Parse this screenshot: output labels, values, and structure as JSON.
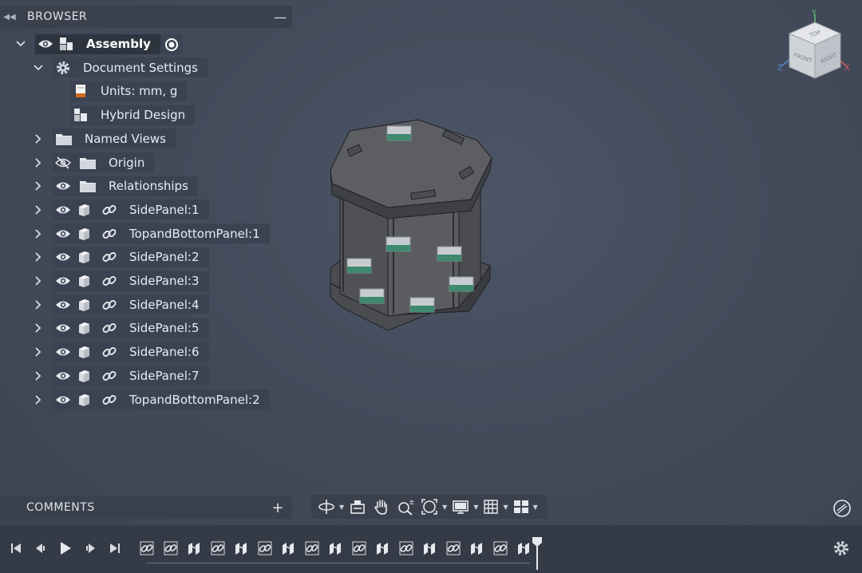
{
  "browser": {
    "title": "BROWSER",
    "tree": [
      {
        "id": "assembly",
        "label": "Assembly",
        "indent": 0,
        "expanded": true,
        "eye": "visible",
        "icon": "component-icon",
        "selected": true,
        "radio": true
      },
      {
        "id": "doc-settings",
        "label": "Document Settings",
        "indent": 1,
        "expanded": true,
        "icon": "gear-icon"
      },
      {
        "id": "units",
        "label": "Units: mm, g",
        "indent": 2,
        "icon": "units-icon"
      },
      {
        "id": "hybrid",
        "label": "Hybrid Design",
        "indent": 2,
        "icon": "hybrid-design-icon"
      },
      {
        "id": "named-views",
        "label": "Named Views",
        "indent": 1,
        "expanded": false,
        "icon": "folder-icon"
      },
      {
        "id": "origin",
        "label": "Origin",
        "indent": 1,
        "expanded": false,
        "eye": "hidden",
        "icon": "folder-icon"
      },
      {
        "id": "relationships",
        "label": "Relationships",
        "indent": 1,
        "expanded": false,
        "eye": "visible",
        "icon": "folder-icon"
      },
      {
        "id": "sidepanel1",
        "label": "SidePanel:1",
        "indent": 1,
        "expanded": false,
        "eye": "visible",
        "icon": "body-icon",
        "link": true
      },
      {
        "id": "topbottom1",
        "label": "TopandBottomPanel:1",
        "indent": 1,
        "expanded": false,
        "eye": "visible",
        "icon": "body-icon",
        "link": true
      },
      {
        "id": "sidepanel2",
        "label": "SidePanel:2",
        "indent": 1,
        "expanded": false,
        "eye": "visible",
        "icon": "body-icon",
        "link": true
      },
      {
        "id": "sidepanel3",
        "label": "SidePanel:3",
        "indent": 1,
        "expanded": false,
        "eye": "visible",
        "icon": "body-icon",
        "link": true
      },
      {
        "id": "sidepanel4",
        "label": "SidePanel:4",
        "indent": 1,
        "expanded": false,
        "eye": "visible",
        "icon": "body-icon",
        "link": true
      },
      {
        "id": "sidepanel5",
        "label": "SidePanel:5",
        "indent": 1,
        "expanded": false,
        "eye": "visible",
        "icon": "body-icon",
        "link": true
      },
      {
        "id": "sidepanel6",
        "label": "SidePanel:6",
        "indent": 1,
        "expanded": false,
        "eye": "visible",
        "icon": "body-icon",
        "link": true
      },
      {
        "id": "sidepanel7",
        "label": "SidePanel:7",
        "indent": 1,
        "expanded": false,
        "eye": "visible",
        "icon": "body-icon",
        "link": true
      },
      {
        "id": "topbottom2",
        "label": "TopandBottomPanel:2",
        "indent": 1,
        "expanded": false,
        "eye": "visible",
        "icon": "body-icon",
        "link": true
      }
    ]
  },
  "comments": {
    "title": "COMMENTS"
  },
  "viewcube": {
    "top": "TOP",
    "front": "FRONT",
    "right": "RIGHT",
    "axis_y": "Y",
    "axis_x": "X",
    "axis_z": "Z"
  },
  "colors": {
    "viewport_bg": "#454d5c",
    "panel_bg": "#3b4352",
    "selected_bg": "#2e343e",
    "timeline_bg": "#353b46",
    "joint_green": "#3f8a6f"
  },
  "navbar": {
    "tools": [
      "orbit-icon",
      "look-at-icon",
      "pan-hand-icon",
      "zoom-icon",
      "fit-icon",
      "display-settings-icon",
      "grid-icon",
      "viewports-icon"
    ]
  },
  "timeline": {
    "features": [
      "joint-icon",
      "joint-icon",
      "rigid-group-icon",
      "joint-icon",
      "rigid-group-icon",
      "joint-icon",
      "rigid-group-icon",
      "joint-icon",
      "rigid-group-icon",
      "joint-icon",
      "rigid-group-icon",
      "joint-icon",
      "rigid-group-icon",
      "joint-icon",
      "rigid-group-icon",
      "joint-icon",
      "rigid-group-icon"
    ]
  }
}
